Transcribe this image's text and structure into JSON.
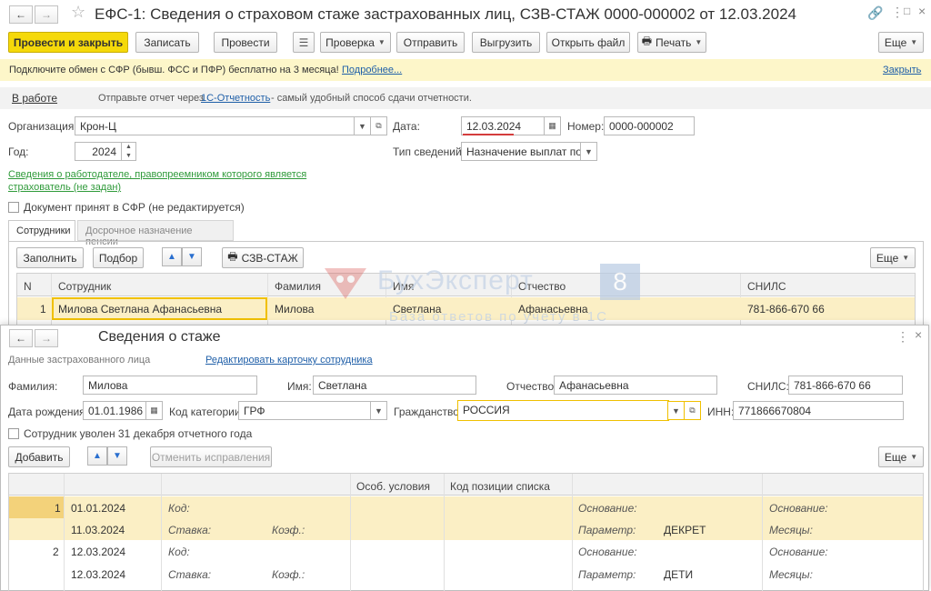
{
  "main": {
    "title": "ЕФС-1: Сведения о страховом стаже застрахованных лиц, СЗВ-СТАЖ 0000-000002 от 12.03.2024",
    "toolbar": {
      "post_close": "Провести и закрыть",
      "save": "Записать",
      "post": "Провести",
      "check": "Проверка",
      "send": "Отправить",
      "export": "Выгрузить",
      "open_file": "Открыть файл",
      "print": "Печать",
      "more": "Еще"
    },
    "banner": {
      "text": "Подключите обмен с СФР (бывш. ФСС и ПФР) бесплатно на 3 месяца!",
      "more": "Подробнее...",
      "close": "Закрыть"
    },
    "status": {
      "state": "В работе",
      "hint_prefix": "Отправьте отчет через",
      "hint_link": "1С-Отчетность",
      "hint_suffix": "- самый удобный способ сдачи отчетности."
    },
    "org_label": "Организация:",
    "org_value": "Крон-Ц",
    "date_label": "Дата:",
    "date_value": "12.03.2024",
    "number_label": "Номер:",
    "number_value": "0000-000002",
    "year_label": "Год:",
    "year_value": "2024",
    "type_label": "Тип сведений:",
    "type_value": "Назначение выплат по ОС",
    "employer_link_1": "Сведения о работодателе, правопреемником которого является",
    "employer_link_2": "страхователь (не задан)",
    "accepted_label": "Документ принят в СФР (не редактируется)",
    "tabs": [
      "Сотрудники",
      "Досрочное назначение пенсии"
    ],
    "table_toolbar": {
      "fill": "Заполнить",
      "select": "Подбор",
      "szv": "СЗВ-СТАЖ",
      "more": "Еще"
    },
    "columns": [
      "N",
      "Сотрудник",
      "Фамилия",
      "Имя",
      "Отчество",
      "СНИЛС"
    ],
    "rows": [
      {
        "n": "1",
        "employee": "Милова Светлана Афанасьевна",
        "last": "Милова",
        "first": "Светлана",
        "middle": "Афанасьевна",
        "snils": "781-866-670 66"
      }
    ],
    "watermark_1": "БухЭксперт",
    "watermark_num": "8",
    "watermark_2": "База ответов по учету в 1С"
  },
  "dialog": {
    "title": "Сведения о стаже",
    "section": "Данные застрахованного лица",
    "edit_link": "Редактировать карточку сотрудника",
    "last_label": "Фамилия:",
    "last_value": "Милова",
    "first_label": "Имя:",
    "first_value": "Светлана",
    "middle_label": "Отчество:",
    "middle_value": "Афанасьевна",
    "snils_label": "СНИЛС:",
    "snils_value": "781-866-670 66",
    "birth_label": "Дата рождения:",
    "birth_value": "01.01.1986",
    "cat_label": "Код категории:",
    "cat_value": "ГРФ",
    "cit_label": "Гражданство:",
    "cit_value": "РОССИЯ",
    "inn_label": "ИНН:",
    "inn_value": "771866670804",
    "fired_label": "Сотрудник уволен 31 декабря отчетного года",
    "add": "Добавить",
    "cancel_fix": "Отменить исправления",
    "more": "Еще",
    "columns": [
      "Особ. условия",
      "Код позиции списка"
    ],
    "labels": {
      "code": "Код:",
      "rate": "Ставка:",
      "coef": "Коэф.:",
      "basis": "Основание:",
      "param": "Параметр:",
      "months": "Месяцы:"
    },
    "periods": [
      {
        "n": "1",
        "start": "01.01.2024",
        "end": "11.03.2024",
        "param": "ДЕКРЕТ"
      },
      {
        "n": "2",
        "start": "12.03.2024",
        "end": "12.03.2024",
        "param": "ДЕТИ"
      }
    ]
  },
  "colors": {
    "accent_yellow": "#f5d90a",
    "selected_row": "#fbefc5",
    "link_blue": "#1f5fa8",
    "link_green": "#2f9a3a"
  }
}
